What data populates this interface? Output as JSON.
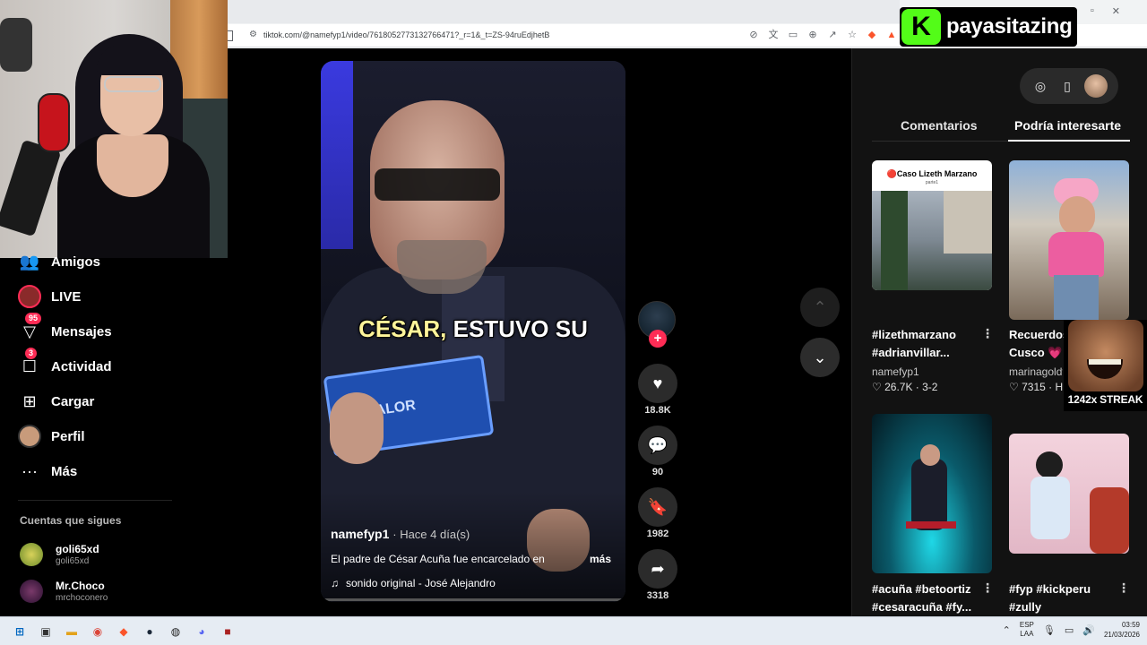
{
  "browser": {
    "url": "tiktok.com/@namefyp1/video/7618052773132766471?_r=1&_t=ZS-94ruEdjhetB"
  },
  "overlay": {
    "channel_name": "payasitazing",
    "kick_letter": "K",
    "streak_text": "1242x STREAK"
  },
  "sidebar": {
    "items": [
      {
        "label": "Amigos",
        "icon": "friends-icon"
      },
      {
        "label": "LIVE",
        "icon": "live-icon"
      },
      {
        "label": "Mensajes",
        "icon": "messages-icon",
        "badge": "95"
      },
      {
        "label": "Actividad",
        "icon": "activity-icon",
        "badge": "3"
      },
      {
        "label": "Cargar",
        "icon": "upload-icon"
      },
      {
        "label": "Perfil",
        "icon": "profile-icon"
      },
      {
        "label": "Más",
        "icon": "more-icon"
      }
    ],
    "following_title": "Cuentas que sigues",
    "following": [
      {
        "name": "goli65xd",
        "handle": "goli65xd"
      },
      {
        "name": "Mr.Choco",
        "handle": "mrchoconero"
      }
    ]
  },
  "video": {
    "caption_highlight": "CÉSAR,",
    "caption_rest": "ESTUVO SU",
    "card_text": "VALOR",
    "author": "namefyp1",
    "age": "· Hace 4 día(s)",
    "description": "El padre de César Acuña fue encarcelado en",
    "more_label": "más",
    "sound": "sonido original - José Alejandro"
  },
  "actions": {
    "likes": "18.8K",
    "comments": "90",
    "saves": "1982",
    "shares": "3318"
  },
  "right_panel": {
    "tabs": [
      "Comentarios",
      "Podría interesarte"
    ],
    "active_tab": "Podría interesarte",
    "cards": [
      {
        "title": "#lizethmarzano",
        "title2": "#adrianvillar...",
        "user": "namefyp1",
        "stats": "♡ 26.7K · 3-2",
        "overlay_text": "🔴Caso Lizeth Marzano",
        "overlay_sub": "parte1"
      },
      {
        "title": "Recuerdos",
        "title2": "Cusco 💗",
        "user": "marinagoldt",
        "stats": "♡ 7315 · H"
      },
      {
        "title": "#acuña #betoortiz",
        "title2": "#cesaracuña #fy...",
        "user": "",
        "stats": ""
      },
      {
        "title": "#fyp #kickperu",
        "title2": "#zully",
        "user": "",
        "stats": ""
      }
    ]
  },
  "taskbar": {
    "lang_line1": "ESP",
    "lang_line2": "LAA",
    "time": "03:59",
    "date": "21/03/2026"
  }
}
